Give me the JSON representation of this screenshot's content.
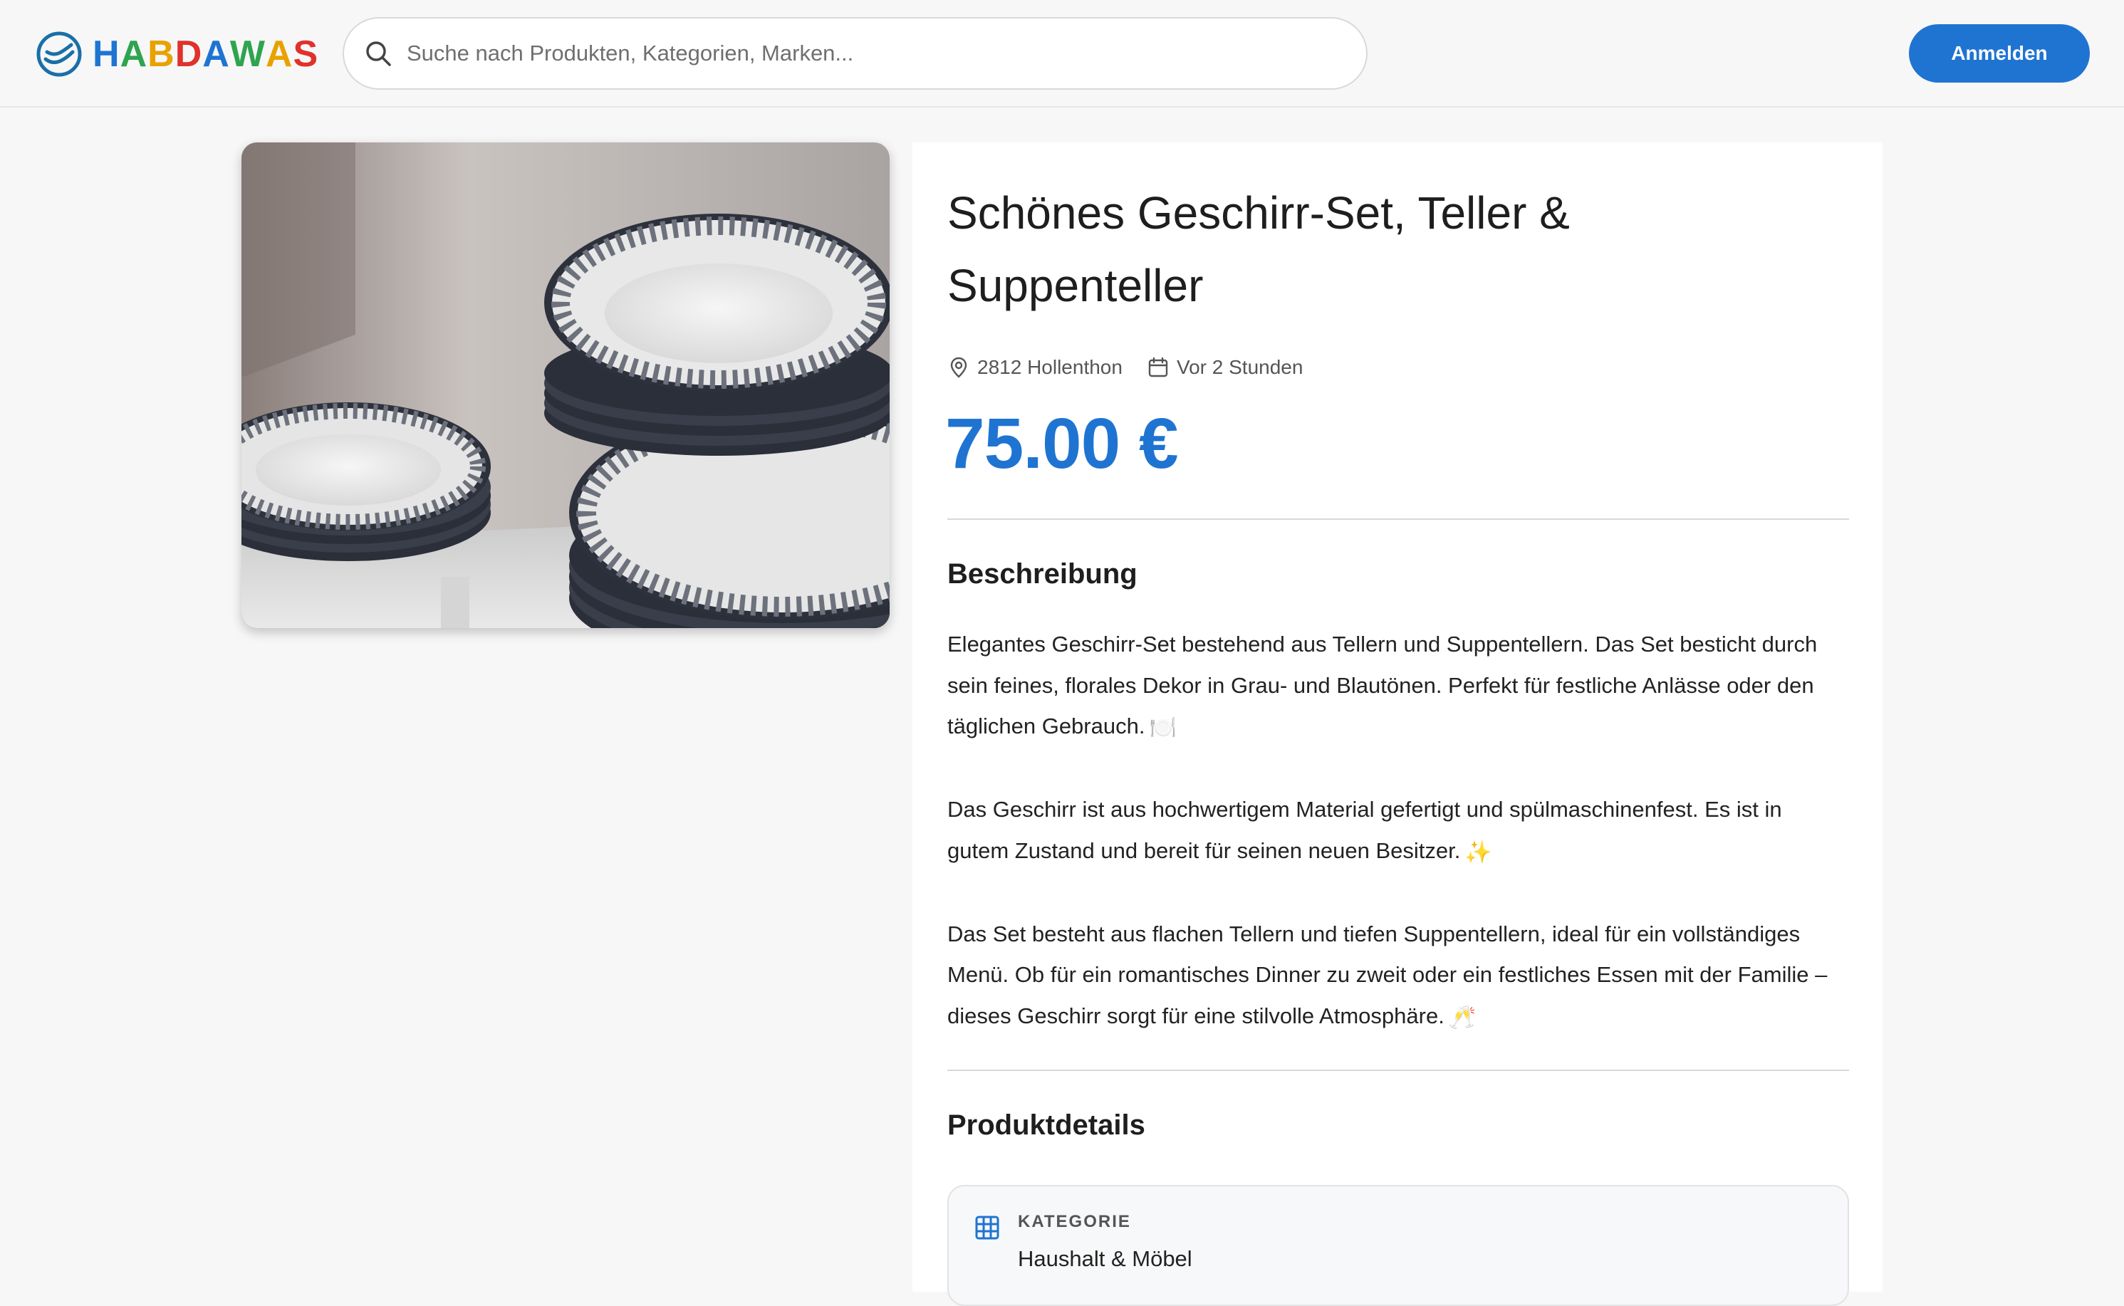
{
  "header": {
    "logo_text": "HABDAWAS",
    "logo_letters": [
      "H",
      "A",
      "B",
      "D",
      "A",
      "W",
      "A",
      "S"
    ],
    "logo_colors": [
      "#1f74d2",
      "#2ea44f",
      "#e8a200",
      "#e0322b",
      "#1f74d2",
      "#2ea44f",
      "#e8a200",
      "#e0322b"
    ],
    "search_placeholder": "Suche nach Produkten, Kategorien, Marken...",
    "login_label": "Anmelden"
  },
  "product": {
    "image_description": "plates-photo",
    "title": "Schönes Geschirr-Set, Teller & Suppenteller",
    "location": "2812 Hollenthon",
    "posted": "Vor 2 Stunden",
    "price": "75.00 €",
    "description_heading": "Beschreibung",
    "description": [
      {
        "text": "Elegantes Geschirr-Set bestehend aus Tellern und Suppentellern. Das Set besticht durch sein feines, florales Dekor in Grau- und Blautönen. Perfekt für festliche Anlässe oder den täglichen Gebrauch.",
        "emoji": "🍽️"
      },
      {
        "text": "Das Geschirr ist aus hochwertigem Material gefertigt und spülmaschinenfest. Es ist in gutem Zustand und bereit für seinen neuen Besitzer.",
        "emoji": "✨"
      },
      {
        "text": "Das Set besteht aus flachen Tellern und tiefen Suppentellern, ideal für ein vollständiges Menü. Ob für ein romantisches Dinner zu zweit oder ein festliches Essen mit der Familie – dieses Geschirr sorgt für eine stilvolle Atmosphäre.",
        "emoji": "🥂"
      }
    ],
    "details_heading": "Produktdetails",
    "details": [
      {
        "label": "KATEGORIE",
        "value": "Haushalt & Möbel",
        "icon": "grid-icon"
      }
    ]
  },
  "colors": {
    "accent": "#1f74d2",
    "background": "#f7f7f7"
  }
}
